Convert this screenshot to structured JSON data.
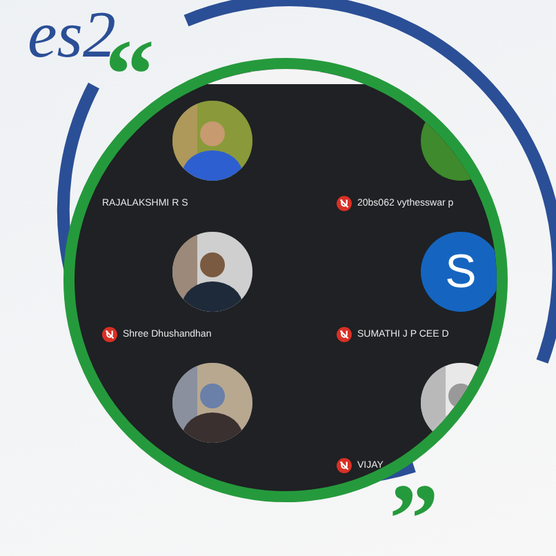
{
  "heading_fragment": "es2",
  "quotes": {
    "open": "“",
    "close": "”"
  },
  "participants": [
    {
      "name": "RAJALAKSHMI R S",
      "muted": false,
      "avatar": {
        "kind": "picture"
      }
    },
    {
      "name": "20bs062 vythesswar p",
      "muted": true,
      "avatar": {
        "kind": "letter",
        "color": "#3e8a2c"
      }
    },
    {
      "name": "Shree Dhushandhan",
      "muted": true,
      "avatar": {
        "kind": "picture"
      }
    },
    {
      "name": "SUMATHI J P CEE D",
      "muted": true,
      "avatar": {
        "kind": "letter",
        "letter": "S",
        "color": "#1565c0"
      }
    },
    {
      "avatar": {
        "kind": "picture"
      }
    },
    {
      "name": "VIJAY",
      "muted": true,
      "avatar": {
        "kind": "picture"
      }
    }
  ]
}
